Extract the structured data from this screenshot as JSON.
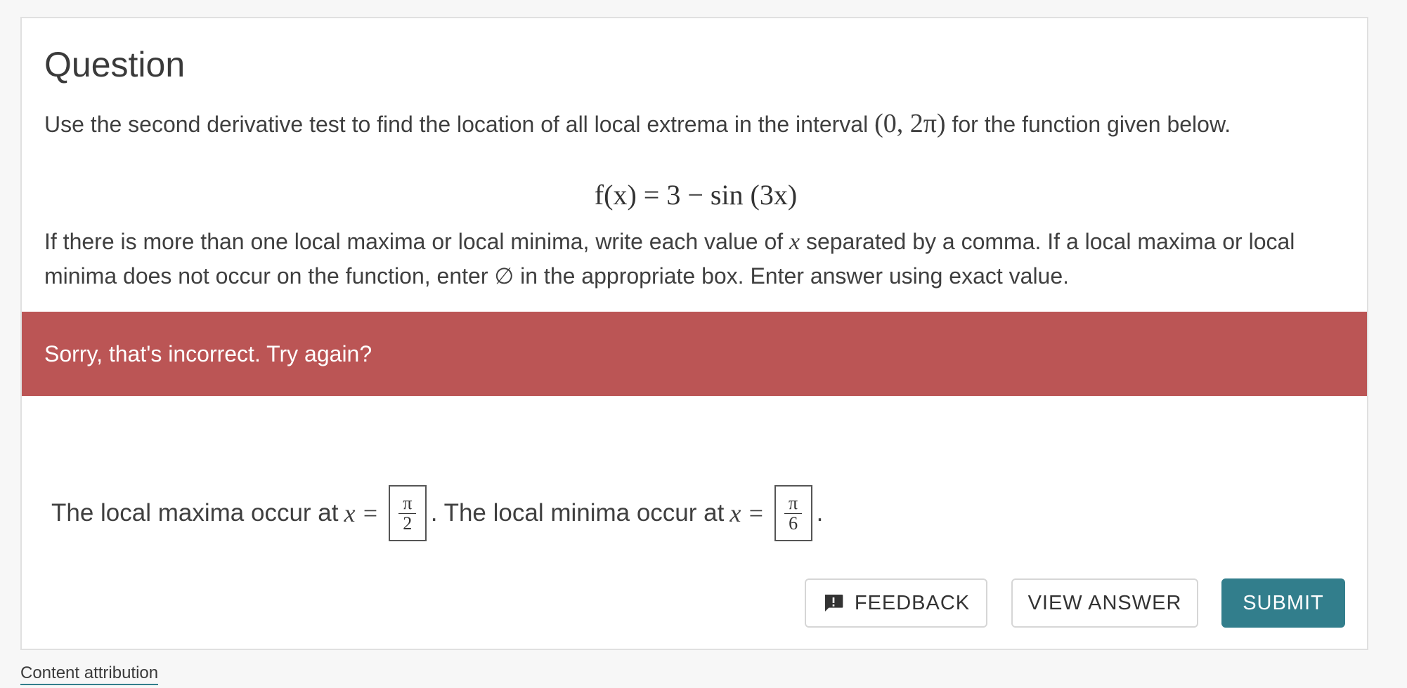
{
  "question": {
    "title": "Question",
    "prompt_before": "Use the second derivative test to find the location of all local extrema in the interval ",
    "interval": "(0, 2π)",
    "prompt_after": " for the function given below.",
    "equation": "f(x) = 3 − sin (3x)",
    "instructions_part1": "If there is more than one local maxima or local minima, write each value of ",
    "instructions_var": "x",
    "instructions_part2": " separated by a comma. If a local maxima or local minima does not occur on the function, enter ∅ in the appropriate box. Enter answer using exact value."
  },
  "feedback": {
    "message": "Sorry, that's incorrect. Try again?",
    "color": "#bb5555"
  },
  "answer": {
    "maxima_label": "The local maxima occur at",
    "minima_label": ". The local minima occur at",
    "var_eq": "x =",
    "end_punct": ".",
    "maxima_value": {
      "numerator": "π",
      "denominator": "2"
    },
    "minima_value": {
      "numerator": "π",
      "denominator": "6"
    }
  },
  "buttons": {
    "feedback": "FEEDBACK",
    "view_answer": "VIEW ANSWER",
    "submit": "SUBMIT",
    "submit_color": "#327e8c",
    "feedback_icon": "comment-alert-icon"
  },
  "footer": {
    "attribution": "Content attribution"
  }
}
